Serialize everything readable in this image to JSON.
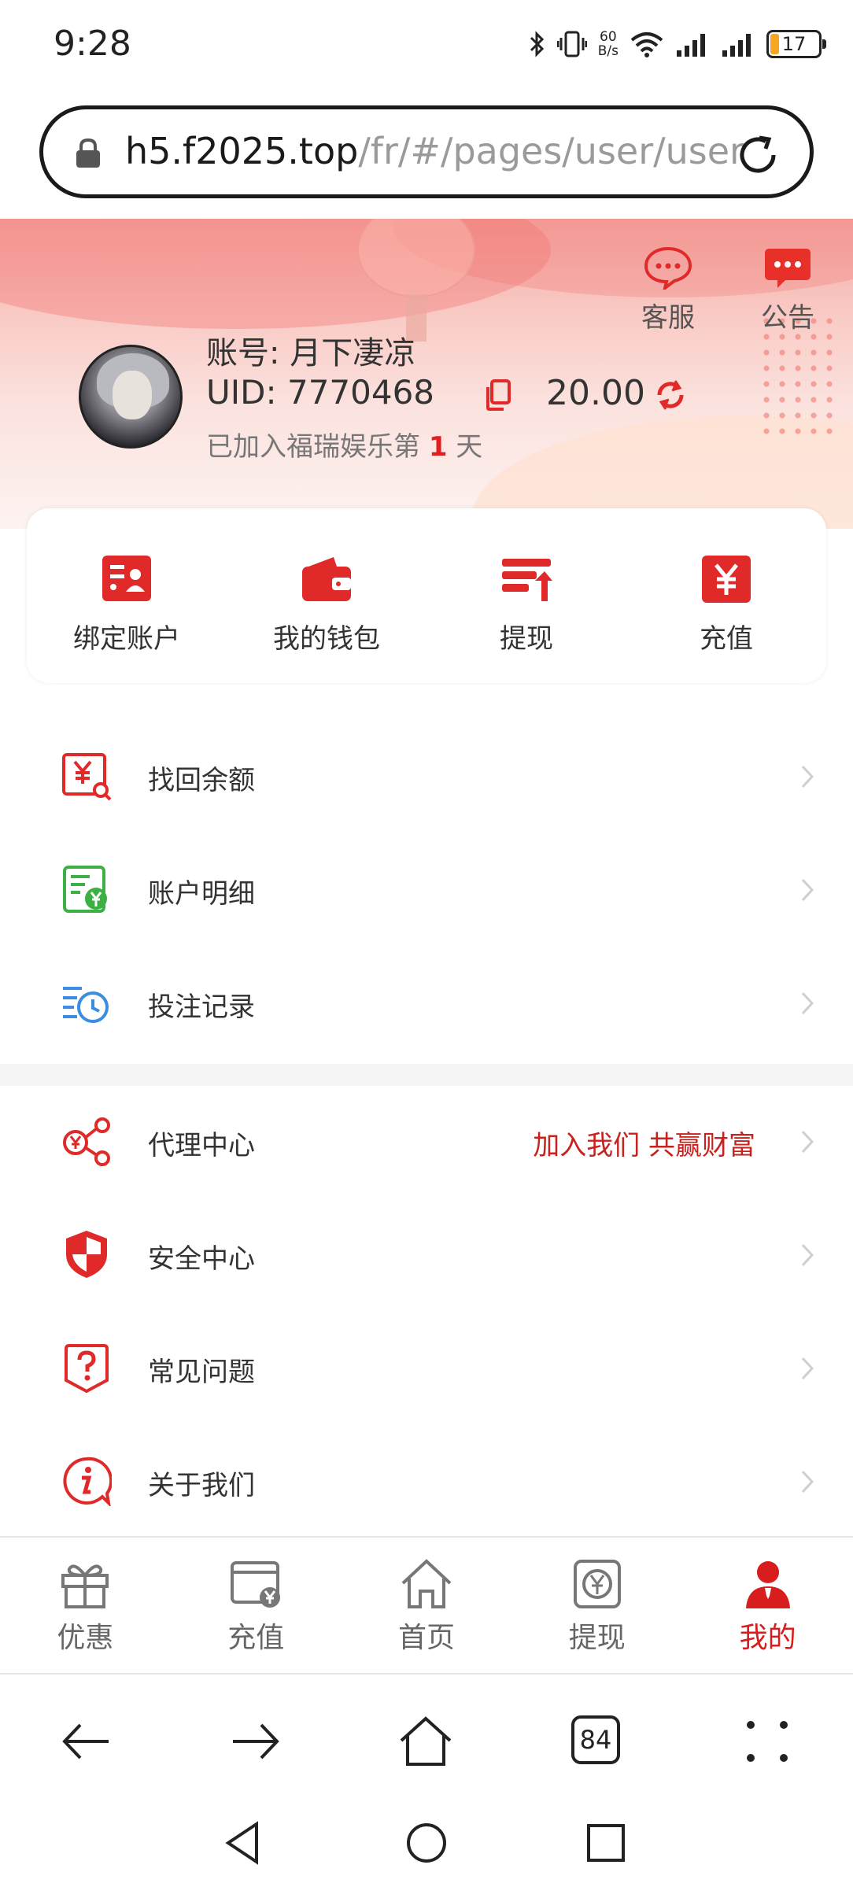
{
  "status_bar": {
    "time": "9:28",
    "net_speed_value": "60",
    "net_speed_unit": "B/s",
    "battery_level": "17"
  },
  "browser": {
    "url_host": "h5.f2025.top",
    "url_path": "/fr/#/pages/user/user",
    "tab_count": "84"
  },
  "header": {
    "service_label": "客服",
    "notice_label": "公告",
    "account_line": "账号:  月下凄凉",
    "uid_line": "UID:  7770468",
    "balance": "20.00",
    "joined_prefix": "已加入福瑞娱乐第 ",
    "joined_days": "1",
    "joined_suffix": " 天"
  },
  "quick_actions": [
    {
      "label": "绑定账户",
      "icon": "bind-account-icon"
    },
    {
      "label": "我的钱包",
      "icon": "wallet-icon"
    },
    {
      "label": "提现",
      "icon": "withdraw-icon"
    },
    {
      "label": "充值",
      "icon": "recharge-icon"
    }
  ],
  "menu": {
    "recover_balance": "找回余额",
    "account_details": "账户明细",
    "bet_records": "投注记录",
    "agent_center": "代理中心",
    "agent_promo": "加入我们 共赢财富",
    "security_center": "安全中心",
    "faq": "常见问题",
    "about_us": "关于我们"
  },
  "tab_bar": {
    "promo": "优惠",
    "recharge": "充值",
    "home": "首页",
    "withdraw": "提现",
    "mine": "我的",
    "active": "mine"
  },
  "colors": {
    "accent": "#d71d1d",
    "promo_text": "#c8221f",
    "green_icon": "#3cb043",
    "blue_icon": "#3a8de0"
  }
}
